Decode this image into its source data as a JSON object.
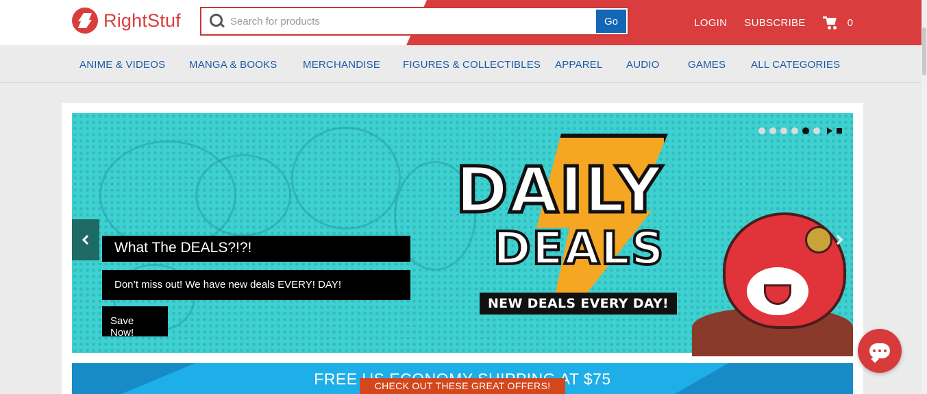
{
  "header": {
    "logo_text": "RightStuf",
    "search_placeholder": "Search for products",
    "search_value": "",
    "go_label": "Go",
    "login_label": "LOGIN",
    "subscribe_label": "SUBSCRIBE",
    "cart_count": "0"
  },
  "nav": {
    "items": [
      {
        "label": "ANIME & VIDEOS"
      },
      {
        "label": "MANGA & BOOKS"
      },
      {
        "label": "MERCHANDISE"
      },
      {
        "label": "FIGURES & COLLECTIBLES"
      },
      {
        "label": "APPAREL"
      },
      {
        "label": "AUDIO"
      },
      {
        "label": "GAMES"
      },
      {
        "label": "ALL CATEGORIES"
      }
    ]
  },
  "banner": {
    "slide_count": 6,
    "active_slide": 5,
    "caption_title": "What The DEALS?!?!",
    "caption_text": "Don’t miss out! We have new deals EVERY! DAY!",
    "cta_label": "Save Now!",
    "art_title_line1": "DAILY",
    "art_title_line2": "DEALS",
    "art_tagline": "NEW DEALS EVERY DAY!"
  },
  "shipping": {
    "text": "FREE US ECONOMY SHIPPING AT $75"
  },
  "offers": {
    "label": "CHECK OUT THESE GREAT OFFERS!"
  },
  "colors": {
    "brand_red": "#d93d3d",
    "nav_blue": "#1a5aa6",
    "go_blue": "#1266b4",
    "banner_teal": "#3fd0d0",
    "shipping_blue": "#1eaee8",
    "offers_orange": "#d4461c"
  },
  "icons": [
    "logo-mark-icon",
    "search-icon",
    "cart-icon",
    "chevron-left-icon",
    "chevron-right-icon",
    "play-icon",
    "stop-icon",
    "chat-icon"
  ]
}
